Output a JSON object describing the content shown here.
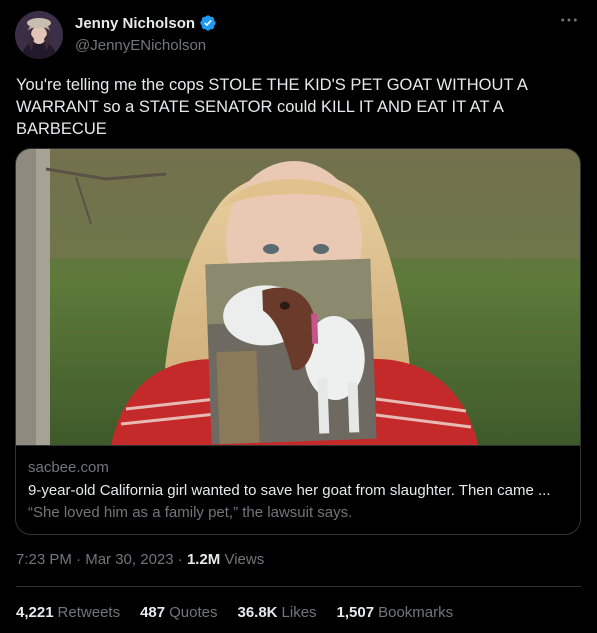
{
  "author": {
    "display_name": "Jenny Nicholson",
    "handle": "@JennyENicholson",
    "verified": true
  },
  "tweet": {
    "text": "You're telling me the cops STOLE THE KID'S PET GOAT WITHOUT A WARRANT so a STATE SENATOR could KILL IT AND EAT IT AT A BARBECUE"
  },
  "link_card": {
    "domain": "sacbee.com",
    "title": "9-year-old California girl wanted to save her goat from slaughter. Then came ...",
    "description": "“She loved him as a family pet,” the lawsuit says."
  },
  "meta": {
    "time": "7:23 PM",
    "separator1": "·",
    "date": "Mar 30, 2023",
    "separator2": "·",
    "views_count": "1.2M",
    "views_label": "Views"
  },
  "stats": {
    "retweets": {
      "count": "4,221",
      "label": "Retweets"
    },
    "quotes": {
      "count": "487",
      "label": "Quotes"
    },
    "likes": {
      "count": "36.8K",
      "label": "Likes"
    },
    "bookmarks": {
      "count": "1,507",
      "label": "Bookmarks"
    }
  },
  "colors": {
    "background": "#000000",
    "text_primary": "#e7e9ea",
    "text_secondary": "#71767b",
    "border": "#2f3336",
    "verified_blue": "#1d9bf0"
  },
  "icons": {
    "verified": "verified-badge-icon",
    "more": "more-options-icon"
  }
}
